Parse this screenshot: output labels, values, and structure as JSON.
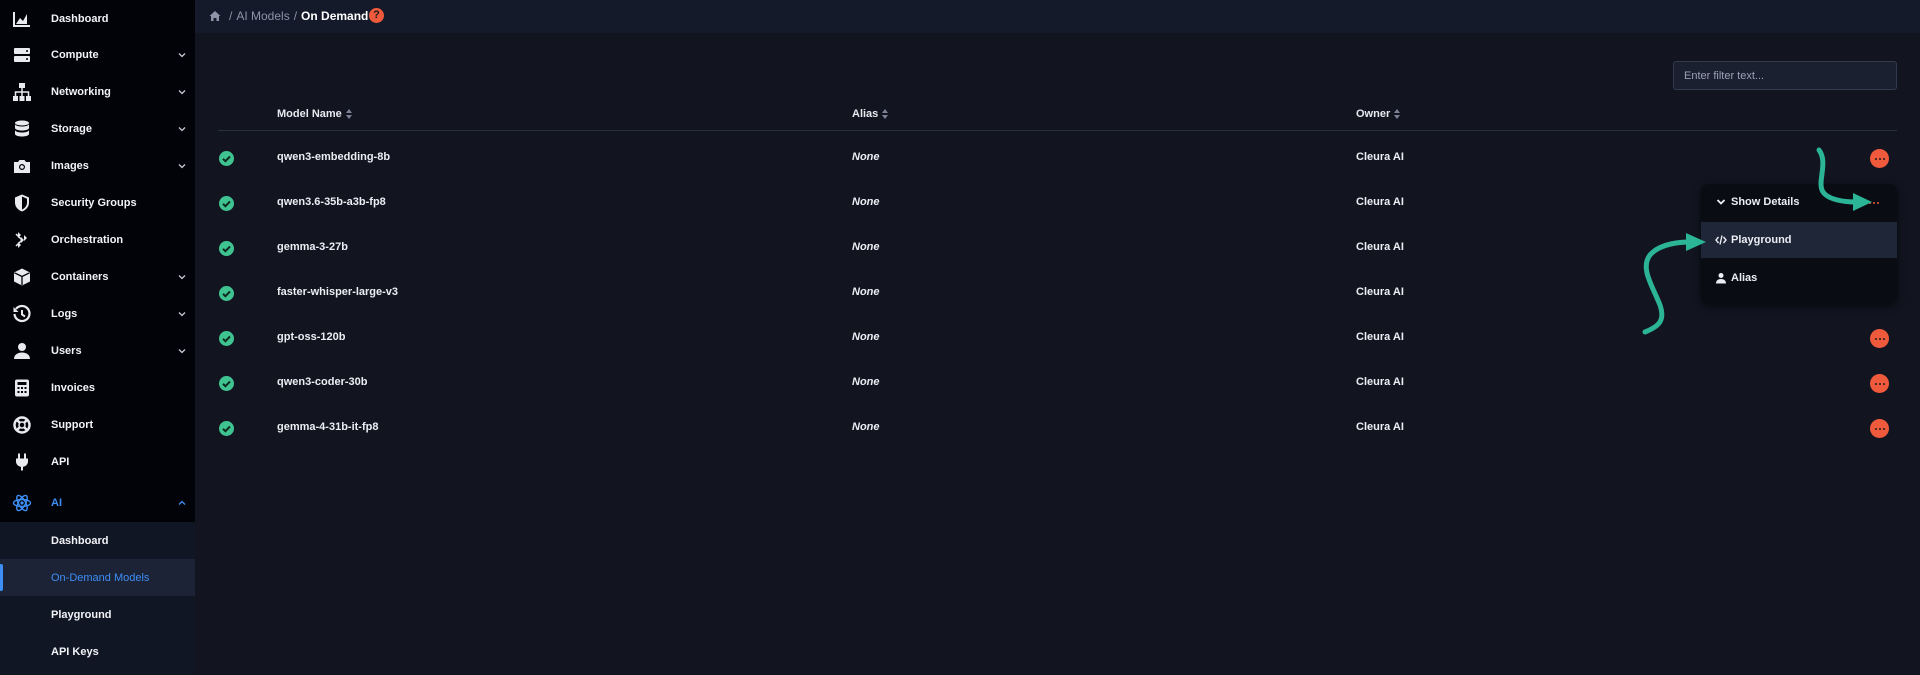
{
  "sidebar": {
    "items": [
      {
        "label": "Dashboard",
        "icon": "chart-area-icon",
        "chevron": false
      },
      {
        "label": "Compute",
        "icon": "server-icon",
        "chevron": true
      },
      {
        "label": "Networking",
        "icon": "network-icon",
        "chevron": true
      },
      {
        "label": "Storage",
        "icon": "database-icon",
        "chevron": true
      },
      {
        "label": "Images",
        "icon": "camera-icon",
        "chevron": true
      },
      {
        "label": "Security Groups",
        "icon": "shield-icon",
        "chevron": false
      },
      {
        "label": "Orchestration",
        "icon": "orchestration-icon",
        "chevron": false
      },
      {
        "label": "Containers",
        "icon": "cube-icon",
        "chevron": true
      },
      {
        "label": "Logs",
        "icon": "history-icon",
        "chevron": true
      },
      {
        "label": "Users",
        "icon": "user-icon",
        "chevron": true
      },
      {
        "label": "Invoices",
        "icon": "calculator-icon",
        "chevron": false
      },
      {
        "label": "Support",
        "icon": "lifebuoy-icon",
        "chevron": false
      },
      {
        "label": "API",
        "icon": "plug-icon",
        "chevron": false
      },
      {
        "label": "AI",
        "icon": "atom-icon",
        "chevron": true
      }
    ],
    "ai_sub": [
      {
        "label": "Dashboard"
      },
      {
        "label": "On-Demand Models"
      },
      {
        "label": "Playground"
      },
      {
        "label": "API Keys"
      }
    ]
  },
  "header": {
    "breadcrumb": [
      "AI Models",
      "On Demand"
    ],
    "help": "?"
  },
  "filter": {
    "placeholder": "Enter filter text..."
  },
  "table": {
    "columns": {
      "model_name": "Model Name",
      "alias": "Alias",
      "owner": "Owner"
    },
    "rows": [
      {
        "model": "qwen3-embedding-8b",
        "alias": "None",
        "owner": "Cleura AI"
      },
      {
        "model": "qwen3.6-35b-a3b-fp8",
        "alias": "None",
        "owner": "Cleura AI"
      },
      {
        "model": "gemma-3-27b",
        "alias": "None",
        "owner": "Cleura AI"
      },
      {
        "model": "faster-whisper-large-v3",
        "alias": "None",
        "owner": "Cleura AI"
      },
      {
        "model": "gpt-oss-120b",
        "alias": "None",
        "owner": "Cleura AI"
      },
      {
        "model": "qwen3-coder-30b",
        "alias": "None",
        "owner": "Cleura AI"
      },
      {
        "model": "gemma-4-31b-it-fp8",
        "alias": "None",
        "owner": "Cleura AI"
      }
    ]
  },
  "menu": {
    "show_details": "Show Details",
    "playground": "Playground",
    "alias": "Alias"
  },
  "colors": {
    "accent_orange": "#f05a3c",
    "accent_blue": "#3d8ef5",
    "status_green": "#3fc391",
    "annotation_teal": "#2bb596"
  }
}
